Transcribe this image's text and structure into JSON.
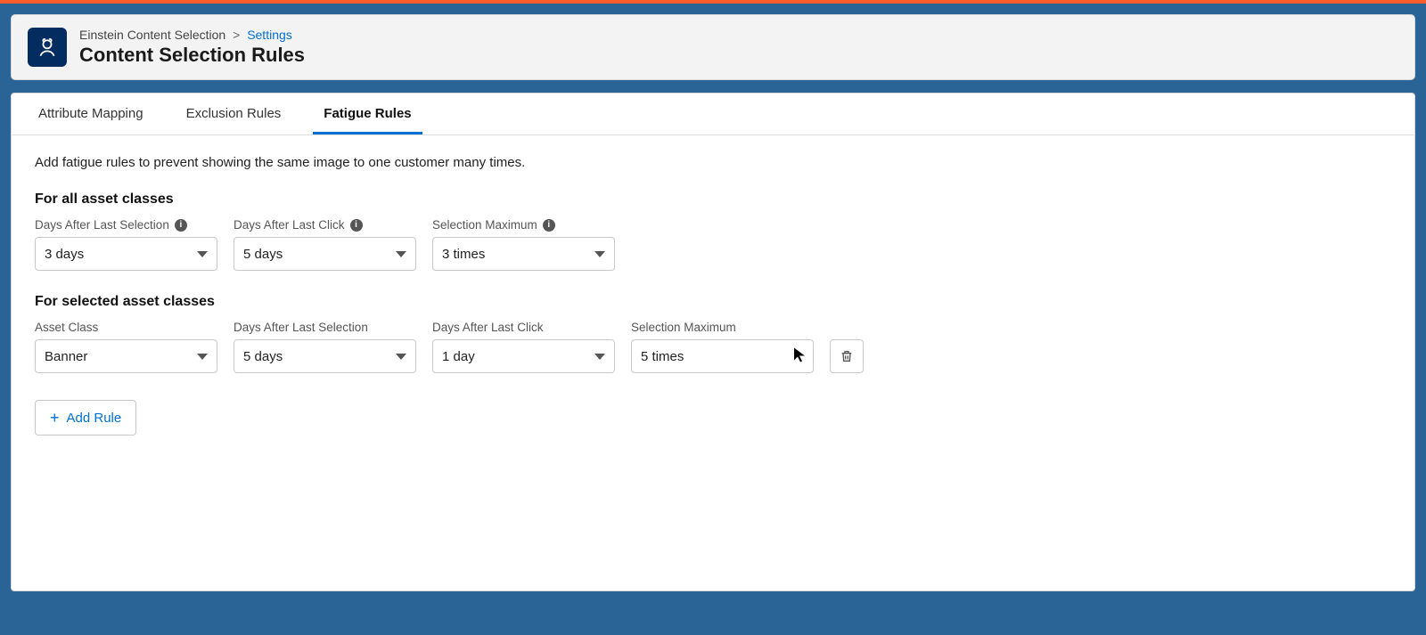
{
  "breadcrumb": {
    "parent": "Einstein Content Selection",
    "current": "Settings"
  },
  "page_title": "Content Selection Rules",
  "tabs": {
    "attribute_mapping": "Attribute Mapping",
    "exclusion_rules": "Exclusion Rules",
    "fatigue_rules": "Fatigue Rules"
  },
  "intro": "Add fatigue rules to prevent showing the same image to one customer many times.",
  "sections": {
    "all": {
      "title": "For all asset classes",
      "fields": {
        "days_after_selection": {
          "label": "Days After Last Selection",
          "value": "3 days"
        },
        "days_after_click": {
          "label": "Days After Last Click",
          "value": "5 days"
        },
        "selection_max": {
          "label": "Selection Maximum",
          "value": "3 times"
        }
      }
    },
    "selected": {
      "title": "For selected asset classes",
      "fields": {
        "asset_class": {
          "label": "Asset Class",
          "value": "Banner"
        },
        "days_after_selection": {
          "label": "Days After Last Selection",
          "value": "5 days"
        },
        "days_after_click": {
          "label": "Days After Last Click",
          "value": "1 day"
        },
        "selection_max": {
          "label": "Selection Maximum",
          "value": "5 times"
        }
      }
    }
  },
  "buttons": {
    "add_rule": "Add Rule"
  }
}
